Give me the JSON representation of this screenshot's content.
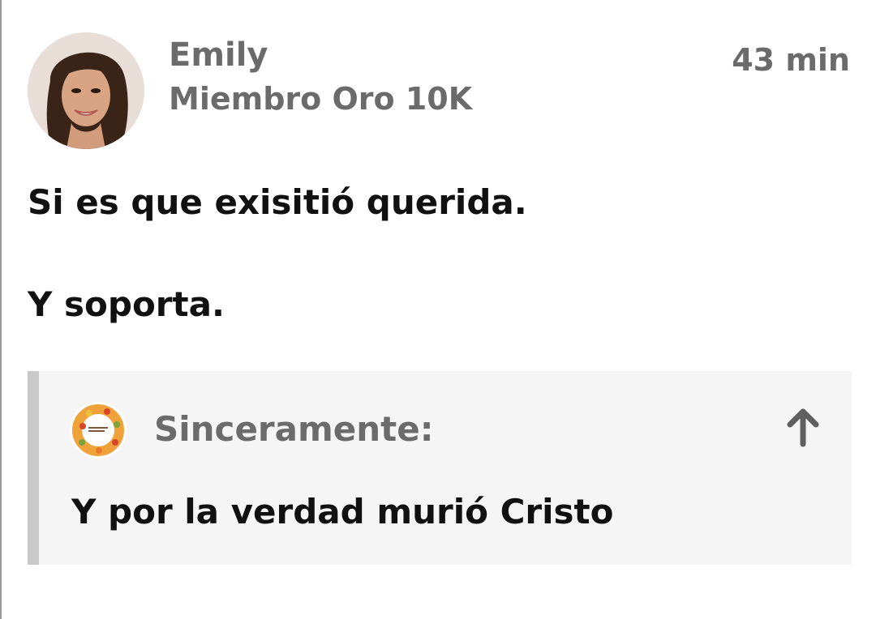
{
  "post": {
    "author": {
      "name": "Emily",
      "rank": "Miembro Oro 10K",
      "avatar_icon": "user-photo-avatar"
    },
    "timestamp": "43 min",
    "body": [
      "Si es que exisitió querida.",
      "Y soporta."
    ],
    "quote": {
      "author_label": "Sinceramente:",
      "avatar_icon": "thanksgiving-wreath-avatar",
      "goto_icon": "arrow-up-icon",
      "text": "Y por la verdad murió Cristo"
    }
  },
  "colors": {
    "meta_text": "#6b6b6b",
    "body_text": "#111111",
    "quote_background": "#f5f5f5",
    "quote_bar": "#c9c9c9"
  }
}
